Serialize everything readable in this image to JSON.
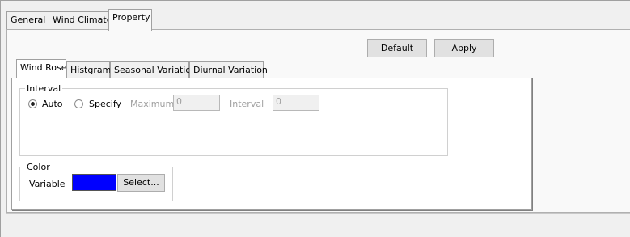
{
  "tabs": [
    "General",
    "Wind Climate",
    "Property"
  ],
  "toolbar": {
    "default_label": "Default",
    "apply_label": "Apply"
  },
  "subtabs": [
    "Wind Rose",
    "Histgram",
    "Seasonal Variation",
    "Diurnal Variation"
  ],
  "interval": {
    "legend": "Interval",
    "auto_label": "Auto",
    "specify_label": "Specify",
    "selected": "Auto",
    "maximum_label": "Maximum",
    "maximum_value": "0",
    "interval_label": "Interval",
    "interval_value": "0"
  },
  "color": {
    "legend": "Color",
    "variable_label": "Variable",
    "swatch_color": "#0000ff",
    "select_label": "Select..."
  }
}
